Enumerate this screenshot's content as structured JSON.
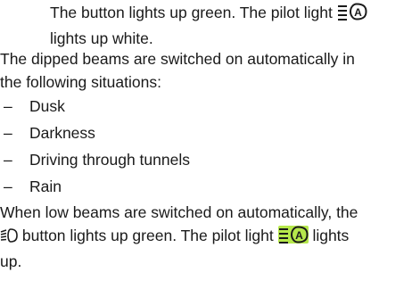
{
  "top_note": {
    "line1": "The button lights up green. The pilot light",
    "line2": "lights up white."
  },
  "intro": {
    "line1": "The dipped beams are switched on automatically in",
    "line2": "the following situations:"
  },
  "situations": [
    {
      "dash": "–",
      "label": "Dusk"
    },
    {
      "dash": "–",
      "label": "Darkness"
    },
    {
      "dash": "–",
      "label": "Driving through tunnels"
    },
    {
      "dash": "–",
      "label": "Rain"
    }
  ],
  "low_beams": {
    "line1": "When low beams are switched on automatically, the",
    "line2_after_icon": "button lights up green. The pilot light",
    "line2_end": "lights",
    "line3": "up."
  },
  "icons": {
    "auto_light_white": "auto-headlight-pilot-icon",
    "low_beam_button": "low-beam-icon",
    "auto_light_green": "auto-headlight-pilot-icon",
    "pilot_highlight_color": "#b6e84b"
  }
}
